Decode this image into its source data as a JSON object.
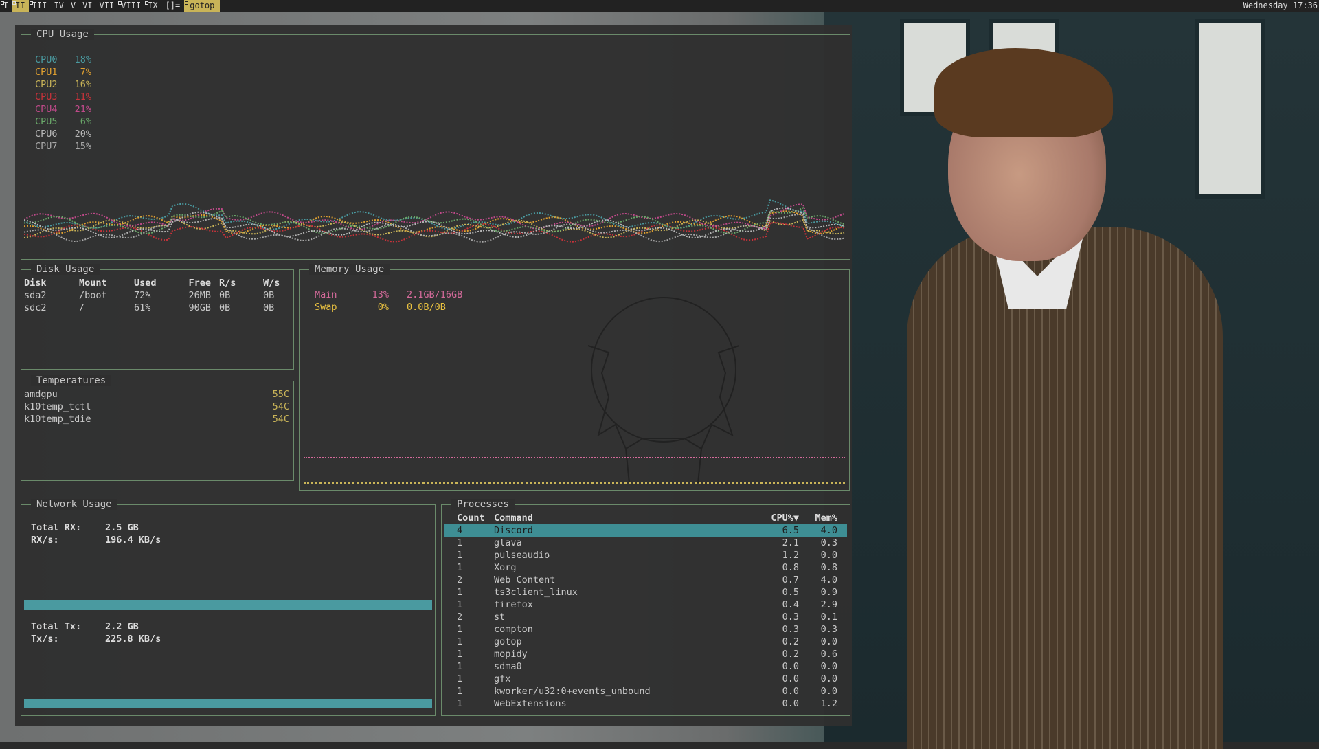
{
  "statusbar": {
    "tags": [
      {
        "label": "I",
        "occupied": true,
        "active": false
      },
      {
        "label": "II",
        "occupied": true,
        "active": true
      },
      {
        "label": "III",
        "occupied": true,
        "active": false
      },
      {
        "label": "IV",
        "occupied": false,
        "active": false
      },
      {
        "label": "V",
        "occupied": false,
        "active": false
      },
      {
        "label": "VI",
        "occupied": false,
        "active": false
      },
      {
        "label": "VII",
        "occupied": false,
        "active": false
      },
      {
        "label": "VIII",
        "occupied": true,
        "active": false
      },
      {
        "label": "IX",
        "occupied": true,
        "active": false
      }
    ],
    "layout_symbol": "[]=",
    "window_title": "gotop",
    "clock": "Wednesday 17:36"
  },
  "cpu": {
    "title": "CPU Usage",
    "cores": [
      {
        "name": "CPU0",
        "value": "18%",
        "color": "#4a9aa0"
      },
      {
        "name": "CPU1",
        "value": "7%",
        "color": "#e0a030"
      },
      {
        "name": "CPU2",
        "value": "16%",
        "color": "#c9b458"
      },
      {
        "name": "CPU3",
        "value": "11%",
        "color": "#c8323a"
      },
      {
        "name": "CPU4",
        "value": "21%",
        "color": "#c04a8a"
      },
      {
        "name": "CPU5",
        "value": "6%",
        "color": "#6aa86a"
      },
      {
        "name": "CPU6",
        "value": "20%",
        "color": "#b8b8b8"
      },
      {
        "name": "CPU7",
        "value": "15%",
        "color": "#a8a8a8"
      }
    ]
  },
  "disk": {
    "title": "Disk Usage",
    "headers": [
      "Disk",
      "Mount",
      "Used",
      "Free",
      "R/s",
      "W/s"
    ],
    "rows": [
      [
        "sda2",
        "/boot",
        "72%",
        "26MB",
        "0B",
        "0B"
      ],
      [
        "sdc2",
        "/",
        "61%",
        "90GB",
        "0B",
        "0B"
      ]
    ]
  },
  "temperatures": {
    "title": "Temperatures",
    "rows": [
      {
        "name": "amdgpu",
        "value": "55C"
      },
      {
        "name": "k10temp_tctl",
        "value": "54C"
      },
      {
        "name": "k10temp_tdie",
        "value": "54C"
      }
    ]
  },
  "memory": {
    "title": "Memory Usage",
    "rows": [
      {
        "name": "Main",
        "pct": "13%",
        "amount": "2.1GB/16GB",
        "color": "#d46a9a"
      },
      {
        "name": "Swap",
        "pct": "0%",
        "amount": "0.0B/0B",
        "color": "#e8c040"
      }
    ]
  },
  "network": {
    "title": "Network Usage",
    "rx": {
      "total_label": "Total RX:",
      "total": "2.5 GB",
      "rate_label": "RX/s:",
      "rate": "196.4 KB/s"
    },
    "tx": {
      "total_label": "Total Tx:",
      "total": "2.2 GB",
      "rate_label": "Tx/s:",
      "rate": "225.8 KB/s"
    }
  },
  "processes": {
    "title": "Processes",
    "headers": [
      "Count",
      "Command",
      "CPU%▼",
      "Mem%"
    ],
    "rows": [
      [
        "4",
        "Discord",
        "6.5",
        "4.0"
      ],
      [
        "1",
        "glava",
        "2.1",
        "0.3"
      ],
      [
        "1",
        "pulseaudio",
        "1.2",
        "0.0"
      ],
      [
        "1",
        "Xorg",
        "0.8",
        "0.8"
      ],
      [
        "2",
        "Web Content",
        "0.7",
        "4.0"
      ],
      [
        "1",
        "ts3client_linux",
        "0.5",
        "0.9"
      ],
      [
        "1",
        "firefox",
        "0.4",
        "2.9"
      ],
      [
        "2",
        "st",
        "0.3",
        "0.1"
      ],
      [
        "1",
        "compton",
        "0.3",
        "0.3"
      ],
      [
        "1",
        "gotop",
        "0.2",
        "0.0"
      ],
      [
        "1",
        "mopidy",
        "0.2",
        "0.6"
      ],
      [
        "1",
        "sdma0",
        "0.0",
        "0.0"
      ],
      [
        "1",
        "gfx",
        "0.0",
        "0.0"
      ],
      [
        "1",
        "kworker/u32:0+events_unbound",
        "0.0",
        "0.0"
      ],
      [
        "1",
        "WebExtensions",
        "0.0",
        "1.2"
      ]
    ]
  }
}
